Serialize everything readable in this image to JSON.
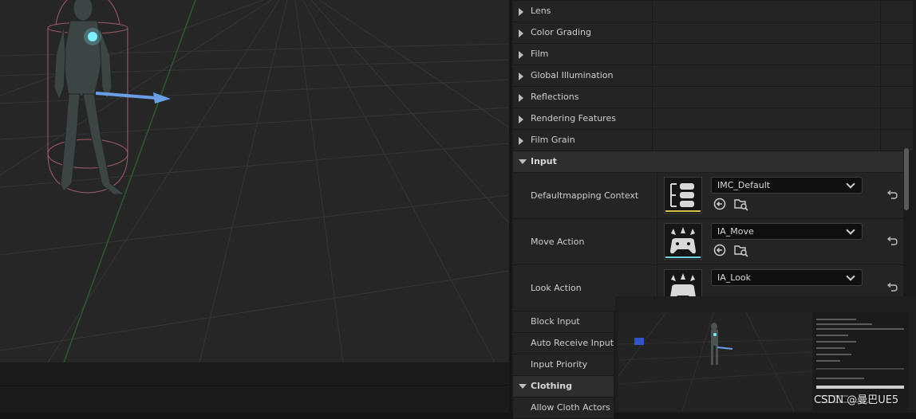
{
  "details": {
    "collapsed_sections": [
      "Lens",
      "Color Grading",
      "Film",
      "Global Illumination",
      "Reflections",
      "Rendering Features",
      "Film Grain"
    ],
    "input_category": "Input",
    "input_properties": [
      {
        "label": "Defaultmapping Context",
        "value": "IMC_Default",
        "thumb_color": "#d6c14a",
        "thumb_icon": "mapping-context-icon"
      },
      {
        "label": "Move Action",
        "value": "IA_Move",
        "thumb_color": "#6fd6e0",
        "thumb_icon": "input-action-icon"
      },
      {
        "label": "Look Action",
        "value": "IA_Look",
        "thumb_color": "#6fd6e0",
        "thumb_icon": "input-action-icon"
      }
    ],
    "more_input": [
      "Block Input",
      "Auto Receive Input",
      "Input Priority"
    ],
    "clothing_category": "Clothing",
    "clothing_properties": [
      "Allow Cloth Actors"
    ]
  },
  "watermark": "CSDN @曼巴UE5",
  "colors": {
    "accent_yellow": "#d6c14a",
    "accent_cyan": "#6fd6e0",
    "arrow_blue": "#6a9fe8"
  }
}
